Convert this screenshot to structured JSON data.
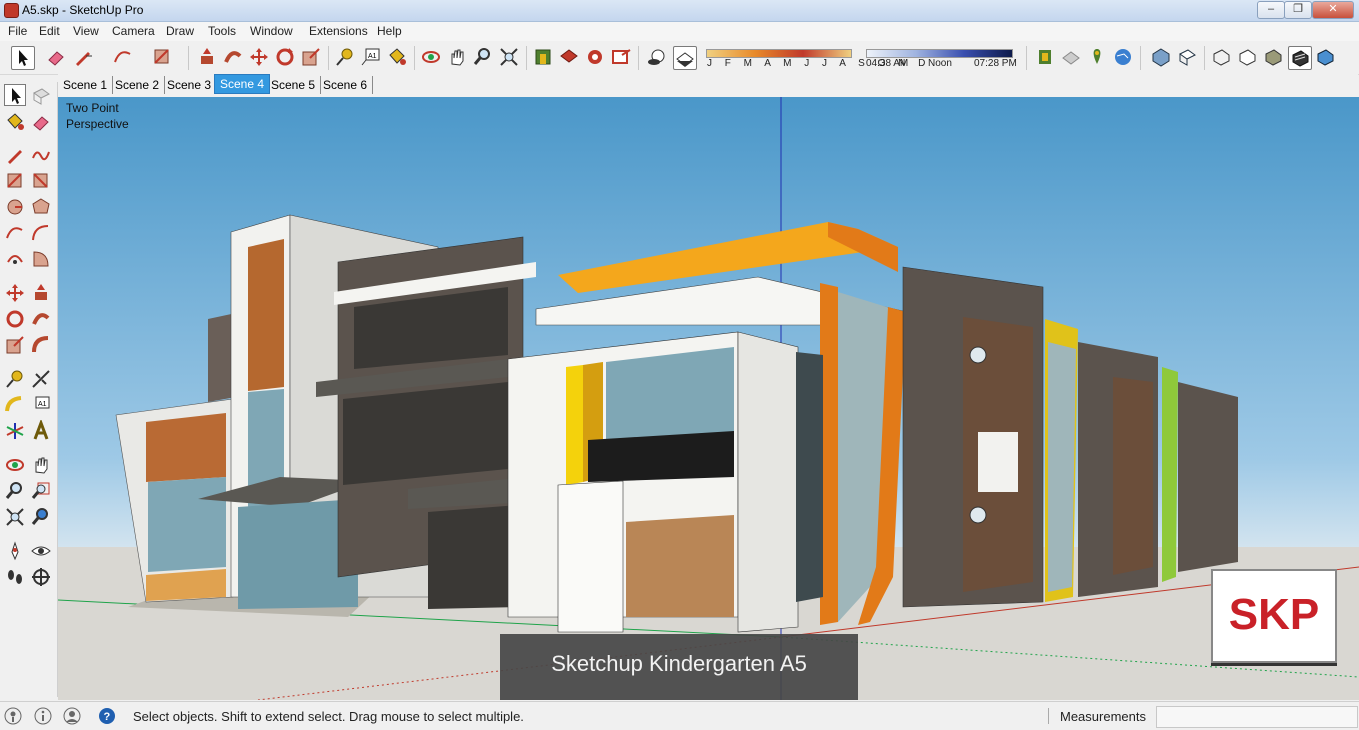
{
  "window": {
    "title": "A5.skp - SketchUp Pro",
    "controls": {
      "minimize": "–",
      "maximize": "❐",
      "close": "✕"
    }
  },
  "menu": {
    "items": [
      "File",
      "Edit",
      "View",
      "Camera",
      "Draw",
      "Tools",
      "Window",
      "Extensions",
      "Help"
    ]
  },
  "shadows": {
    "months": "J F M A M J J A S O N D",
    "time_start": "04:38 AM",
    "time_mid": "Noon",
    "time_end": "07:28 PM"
  },
  "scenes": {
    "tabs": [
      "Scene 1",
      "Scene 2",
      "Scene 3",
      "Scene 4",
      "Scene 5",
      "Scene 6"
    ],
    "active": "Scene 4"
  },
  "viewport": {
    "camera_label": "Two Point\nPerspective",
    "caption": "Sketchup Kindergarten A5",
    "logo_text": "SKP"
  },
  "status": {
    "message": "Select objects. Shift to extend select. Drag mouse to select multiple.",
    "measurements_label": "Measurements",
    "measurements_value": ""
  },
  "colors": {
    "sky_top": "#4a97c9",
    "ground": "#d8d6d1",
    "accent_orange": "#f5871f",
    "accent_yellow": "#f4d20c",
    "axis_blue": "#1f2fb0",
    "axis_red": "#c0392b",
    "axis_green": "#1fa34a",
    "logo_red": "#c92128"
  },
  "icons": {
    "toolbar": [
      "select-icon",
      "eraser-icon",
      "pencil-icon",
      "arc-icon",
      "rectangle-icon",
      "push-pull-icon",
      "follow-me-icon",
      "move-icon",
      "rotate-icon",
      "scale-icon",
      "tape-measure-icon",
      "text-icon",
      "paint-bucket-icon",
      "orbit-icon",
      "pan-icon",
      "zoom-icon",
      "zoom-extents-icon",
      "warehouse-icon",
      "extension-icon",
      "components-icon",
      "send-layout-icon",
      "shadows-icon",
      "fog-icon"
    ],
    "styles": [
      "xray-icon",
      "back-edges-icon",
      "wireframe-icon",
      "hidden-line-icon",
      "shaded-icon",
      "shaded-textures-icon",
      "monochrome-icon"
    ]
  }
}
